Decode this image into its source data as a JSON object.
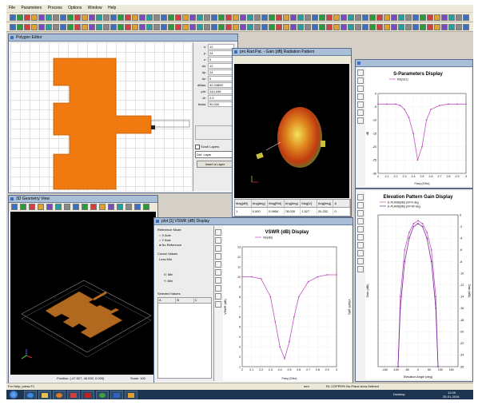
{
  "menubar": {
    "items": [
      "File",
      "Parameters",
      "Process",
      "Options",
      "Window",
      "Help"
    ]
  },
  "polygon_editor": {
    "title": "Polygon Editor",
    "fields": [
      {
        "label": "x:",
        "value": "12"
      },
      {
        "label": "y:",
        "value": "24"
      },
      {
        "label": "z:",
        "value": "0"
      },
      {
        "label": "dx:",
        "value": "12"
      },
      {
        "label": "dy:",
        "value": "24"
      },
      {
        "label": "dz:",
        "value": "0"
      },
      {
        "label": "dMax:",
        "value": "32.24859"
      },
      {
        "label": "phi:",
        "value": "243.095"
      },
      {
        "label": "dr:",
        "value": "2.0"
      },
      {
        "label": "theta:",
        "value": "90.000"
      }
    ],
    "scroll_layers_label": "Scroll Layers",
    "layer_select_value": "Def. Layer",
    "insert_layer_button": "Insert a Layer"
  },
  "view3d": {
    "title": "3D Geometry View",
    "status": "Position: (-47.527, 45.932, 0.000)",
    "scale": "Scale: 100"
  },
  "radiation_view": {
    "title": "pro.Rad.Pat. - Gain [dB] Radiation Pattern",
    "table_headers": [
      "Mag[dB]",
      "Ang[deg]",
      "Mag[Rel]",
      "Ang[deg]",
      "Mag[V]",
      "Ang[deg]",
      "A"
    ],
    "table_row": [
      "1",
      "0.000",
      "0.9954",
      "78.035",
      "1.527",
      "20.232",
      "0"
    ]
  },
  "sparam_display": {
    "title": "S-Parameters Display",
    "legend": [
      "RE(S11)"
    ],
    "ylabel": "dB",
    "xlabel": "Freq (GHz)",
    "x_ticks": [
      "2",
      "2.1",
      "2.2",
      "2.3",
      "2.4",
      "2.5",
      "2.6",
      "2.7",
      "2.8",
      "2.9",
      "3"
    ],
    "y_ticks": [
      "0",
      "-5",
      "-10",
      "-15",
      "-20",
      "-25",
      "-30"
    ]
  },
  "elevation_display": {
    "title": "Elevation Pattern Gain Display",
    "legend": [
      "E-PLANE[dB] phi=0 deg",
      "E-PLANE[dB] phi=90 deg"
    ],
    "xlabel": "Elevation Angle (deg)",
    "ylabel": "Gain (dBi)",
    "y2label": "Gain (dBi)",
    "x_ticks": [
      "-150",
      "-100",
      "-50",
      "0",
      "50",
      "100",
      "150"
    ],
    "y_ticks": [
      "0",
      "-2",
      "-4",
      "-6",
      "-8",
      "-10",
      "-12",
      "-14",
      "-16",
      "-18",
      "-20",
      "-22",
      "-24",
      "-26"
    ]
  },
  "vswr_window": {
    "title": "plot [1] VSWR (dB) Display",
    "reference_title": "Reference Mode",
    "options": [
      "X Axis",
      "Y Axis",
      "No Reference"
    ],
    "cursor_title": "Cursor Values",
    "cursor_value": "Less Min",
    "xmin_label": "X: Min",
    "ymin_label": "Y: Min",
    "selected_title": "Selected Values",
    "col_a": "A",
    "col_b": "B",
    "col_c": "C"
  },
  "vswr_display": {
    "title": "VSWR (dB) Display",
    "legend": [
      "Vin(dB)"
    ],
    "ylabel": "VSWR (dB)",
    "y2label": "VSWR (dB)",
    "xlabel": "Freq (GHz)",
    "x_ticks": [
      "2",
      "2.1",
      "2.2",
      "2.3",
      "2.4",
      "2.5",
      "2.6",
      "2.7",
      "2.8",
      "2.9",
      "3"
    ],
    "y_ticks": [
      "13",
      "12",
      "11",
      "10",
      "9",
      "8",
      "7",
      "6",
      "5",
      "4",
      "3",
      "2",
      "1"
    ]
  },
  "statusbar": {
    "left": "For Help, press F1",
    "mid": "mm",
    "right": "RL COPPER/ No Plane Area Defined"
  },
  "taskbar": {
    "desktop": "Desktop",
    "time": "12:09",
    "date": "25-01-2016"
  },
  "colors": {
    "patch": "#f07a10",
    "plot_line": "#c050c0",
    "titlebar": "#a9bfd8",
    "taskbar": "#1d3550"
  },
  "chart_data": [
    {
      "type": "line",
      "title": "S-Parameters Display",
      "xlabel": "Freq (GHz)",
      "ylabel": "dB",
      "xlim": [
        2,
        3
      ],
      "ylim": [
        -30,
        0
      ],
      "series": [
        {
          "name": "RE(S11)",
          "x": [
            2.0,
            2.1,
            2.2,
            2.25,
            2.3,
            2.35,
            2.4,
            2.45,
            2.5,
            2.55,
            2.6,
            2.7,
            2.8,
            2.9,
            3.0
          ],
          "values": [
            -4,
            -4,
            -4,
            -4.5,
            -6,
            -9,
            -15,
            -25,
            -20,
            -10,
            -6,
            -4.5,
            -4,
            -4,
            -4
          ]
        }
      ]
    },
    {
      "type": "line",
      "title": "Elevation Pattern Gain Display",
      "xlabel": "Elevation Angle (deg)",
      "ylabel": "Gain (dBi)",
      "xlim": [
        -180,
        180
      ],
      "ylim": [
        -26,
        0
      ],
      "series": [
        {
          "name": "E-PLANE[dB] phi=0 deg",
          "x": [
            -90,
            -80,
            -60,
            -40,
            -20,
            0,
            20,
            40,
            60,
            80,
            90
          ],
          "values": [
            -26,
            -14,
            -6,
            -3,
            -1.5,
            -1,
            -1.5,
            -3,
            -6,
            -14,
            -26
          ]
        },
        {
          "name": "E-PLANE[dB] phi=90 deg",
          "x": [
            -90,
            -80,
            -60,
            -40,
            -20,
            0,
            20,
            40,
            60,
            80,
            90
          ],
          "values": [
            -26,
            -16,
            -8,
            -4,
            -2,
            -1.5,
            -2,
            -4,
            -8,
            -16,
            -26
          ]
        }
      ]
    },
    {
      "type": "line",
      "title": "VSWR (dB) Display",
      "xlabel": "Freq (GHz)",
      "ylabel": "VSWR (dB)",
      "xlim": [
        2,
        3
      ],
      "ylim": [
        1,
        13
      ],
      "series": [
        {
          "name": "Vin(dB)",
          "x": [
            2.0,
            2.1,
            2.2,
            2.3,
            2.35,
            2.4,
            2.45,
            2.5,
            2.55,
            2.6,
            2.7,
            2.8,
            2.9,
            3.0
          ],
          "values": [
            10,
            10,
            9.8,
            8,
            5.5,
            3,
            1.8,
            3.5,
            6,
            8,
            9.5,
            10,
            10.2,
            10.2
          ]
        }
      ]
    }
  ]
}
